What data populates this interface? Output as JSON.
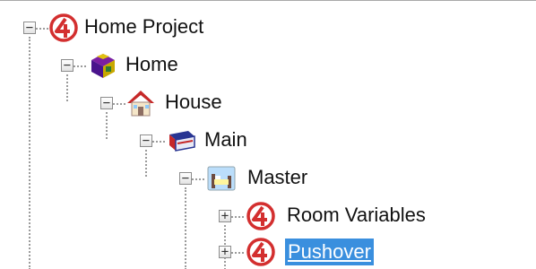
{
  "tree": {
    "nodes": [
      {
        "label": "Home Project",
        "icon": "control4-logo-icon",
        "expanded": true,
        "depth": 0
      },
      {
        "label": "Home",
        "icon": "home-cube-icon",
        "expanded": true,
        "depth": 1
      },
      {
        "label": "House",
        "icon": "house-icon",
        "expanded": true,
        "depth": 2
      },
      {
        "label": "Main",
        "icon": "floor-icon",
        "expanded": true,
        "depth": 3
      },
      {
        "label": "Master",
        "icon": "room-bed-icon",
        "expanded": true,
        "depth": 4
      },
      {
        "label": "Room Variables",
        "icon": "control4-logo-icon",
        "expanded": false,
        "depth": 5
      },
      {
        "label": "Pushover",
        "icon": "control4-logo-icon",
        "expanded": false,
        "depth": 5,
        "selected": true
      }
    ],
    "expanded_glyph": "−",
    "collapsed_glyph": "+",
    "selection_color": "#3a8fde",
    "logo_color": "#d32f2f"
  }
}
